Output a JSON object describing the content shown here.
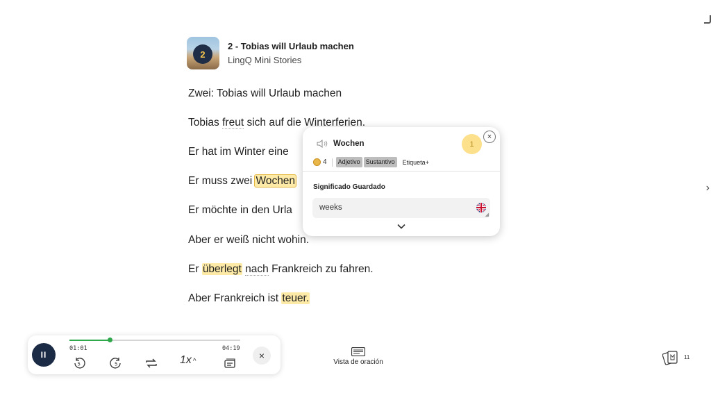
{
  "lesson": {
    "thumb_number": "2",
    "title": "2 - Tobias will Urlaub machen",
    "course": "LingQ Mini Stories"
  },
  "lines": [
    {
      "tokens": [
        {
          "t": "Zwei: Tobias will Urlaub machen",
          "s": "plain"
        }
      ]
    },
    {
      "tokens": [
        {
          "t": "Tobias ",
          "s": "plain"
        },
        {
          "t": "freut",
          "s": "dotted"
        },
        {
          "t": " sich auf die Winterferien.",
          "s": "plain"
        }
      ]
    },
    {
      "tokens": [
        {
          "t": "Er hat im Winter eine ",
          "s": "plain"
        }
      ]
    },
    {
      "tokens": [
        {
          "t": "Er muss zwei ",
          "s": "plain"
        },
        {
          "t": "Wochen",
          "s": "sel"
        }
      ]
    },
    {
      "tokens": [
        {
          "t": "Er möchte in den Urla",
          "s": "plain"
        }
      ]
    },
    {
      "tokens": [
        {
          "t": "Aber er weiß nicht wohin.",
          "s": "plain"
        }
      ]
    },
    {
      "tokens": [
        {
          "t": "Er ",
          "s": "plain"
        },
        {
          "t": "überlegt",
          "s": "hl"
        },
        {
          "t": " ",
          "s": "plain"
        },
        {
          "t": "nach",
          "s": "dotted"
        },
        {
          "t": " Frankreich zu fahren.",
          "s": "plain"
        }
      ]
    },
    {
      "tokens": [
        {
          "t": "Aber Frankreich ist ",
          "s": "plain"
        },
        {
          "t": "teuer.",
          "s": "hl"
        }
      ]
    }
  ],
  "popup": {
    "term": "Wochen",
    "status": "1",
    "coins": "4",
    "tags": [
      "Adjetivo",
      "Sustantivo"
    ],
    "tag_add": "Etiqueta+",
    "section_title": "Significado Guardado",
    "meaning": "weeks",
    "close_icon": "×",
    "expand_icon": "⌄"
  },
  "player": {
    "current": "01:01",
    "total": "04:19",
    "progress": 0.2355,
    "speed": "1x",
    "pause_icon": "II",
    "close_icon": "×"
  },
  "bottom": {
    "sentence_view_label": "Vista de oración",
    "cards_count": "11"
  },
  "colors": {
    "highlight": "#fdeaa7",
    "status_bg": "#fce08b",
    "player_btn": "#1c2b45",
    "progress": "#2ea84a"
  }
}
